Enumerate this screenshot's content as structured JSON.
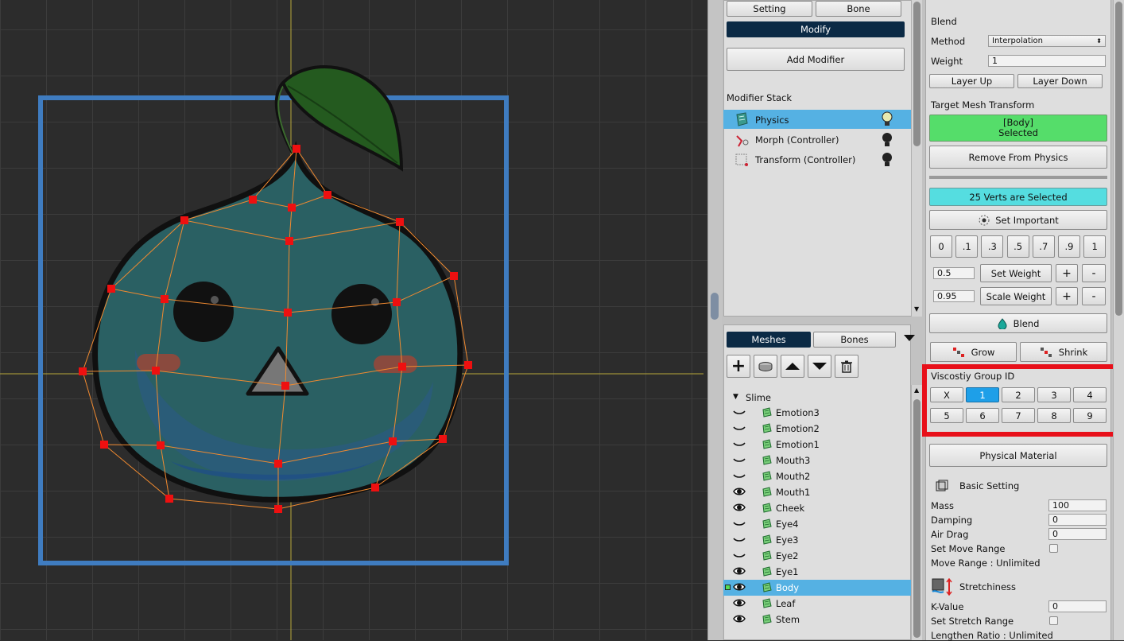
{
  "viewport": {
    "mesh_vertex_count_note": "",
    "bounding_box_color": "#3f7cc0",
    "mesh_line_color": "#f08a30",
    "vertex_color": "#ee1010"
  },
  "middle": {
    "tabs": {
      "setting": "Setting",
      "bone": "Bone"
    },
    "mode": "Modify",
    "add_modifier": "Add Modifier",
    "stack_title": "Modifier Stack",
    "modifiers": [
      {
        "label": "Physics",
        "selected": true
      },
      {
        "label": "Morph (Controller)",
        "selected": false
      },
      {
        "label": "Transform (Controller)",
        "selected": false
      }
    ],
    "bottom_tabs": {
      "meshes": "Meshes",
      "bones": "Bones"
    },
    "tree_root": "Slime",
    "mesh_items": [
      {
        "label": "Emotion3",
        "visible": false,
        "selected": false
      },
      {
        "label": "Emotion2",
        "visible": false,
        "selected": false
      },
      {
        "label": "Emotion1",
        "visible": false,
        "selected": false
      },
      {
        "label": "Mouth3",
        "visible": false,
        "selected": false
      },
      {
        "label": "Mouth2",
        "visible": false,
        "selected": false
      },
      {
        "label": "Mouth1",
        "visible": true,
        "selected": false
      },
      {
        "label": "Cheek",
        "visible": true,
        "selected": false
      },
      {
        "label": "Eye4",
        "visible": false,
        "selected": false
      },
      {
        "label": "Eye3",
        "visible": false,
        "selected": false
      },
      {
        "label": "Eye2",
        "visible": false,
        "selected": false
      },
      {
        "label": "Eye1",
        "visible": true,
        "selected": false
      },
      {
        "label": "Body",
        "visible": true,
        "selected": true
      },
      {
        "label": "Leaf",
        "visible": true,
        "selected": false
      },
      {
        "label": "Stem",
        "visible": true,
        "selected": false
      }
    ]
  },
  "right": {
    "blend_title": "Blend",
    "method_label": "Method",
    "method_value": "Interpolation",
    "weight_label": "Weight",
    "weight_value": "1",
    "layer_up": "Layer Up",
    "layer_down": "Layer Down",
    "target_title": "Target Mesh Transform",
    "target_line1": "[Body]",
    "target_line2": "Selected",
    "remove_btn": "Remove From Physics",
    "verts_selected": "25 Verts are Selected",
    "set_important": "Set Important",
    "presets": [
      "0",
      ".1",
      ".3",
      ".5",
      ".7",
      ".9",
      "1"
    ],
    "set_weight_value": "0.5",
    "set_weight": "Set Weight",
    "scale_weight_value": "0.95",
    "scale_weight": "Scale Weight",
    "plus": "+",
    "minus": "-",
    "blend_btn": "Blend",
    "grow": "Grow",
    "shrink": "Shrink",
    "viscosity_title": "Viscostiy Group ID",
    "viscosity_ids": [
      "X",
      "1",
      "2",
      "3",
      "4",
      "5",
      "6",
      "7",
      "8",
      "9"
    ],
    "viscosity_selected": "1",
    "physical_material": "Physical Material",
    "basic_setting": "Basic Setting",
    "mass_label": "Mass",
    "mass_value": "100",
    "damping_label": "Damping",
    "damping_value": "0",
    "air_drag_label": "Air Drag",
    "air_drag_value": "0",
    "set_move_range": "Set Move Range",
    "move_range": "Move Range : Unlimited",
    "stretchiness": "Stretchiness",
    "k_value_label": "K-Value",
    "k_value": "0",
    "set_stretch_range": "Set Stretch Range",
    "lengthen_ratio": "Lengthen Ratio : Unlimited",
    "colors": {
      "target": "#55dd6a",
      "verts": "#55dde0",
      "selected_id": "#1e9fe8",
      "highlight": "#e8101a"
    }
  }
}
